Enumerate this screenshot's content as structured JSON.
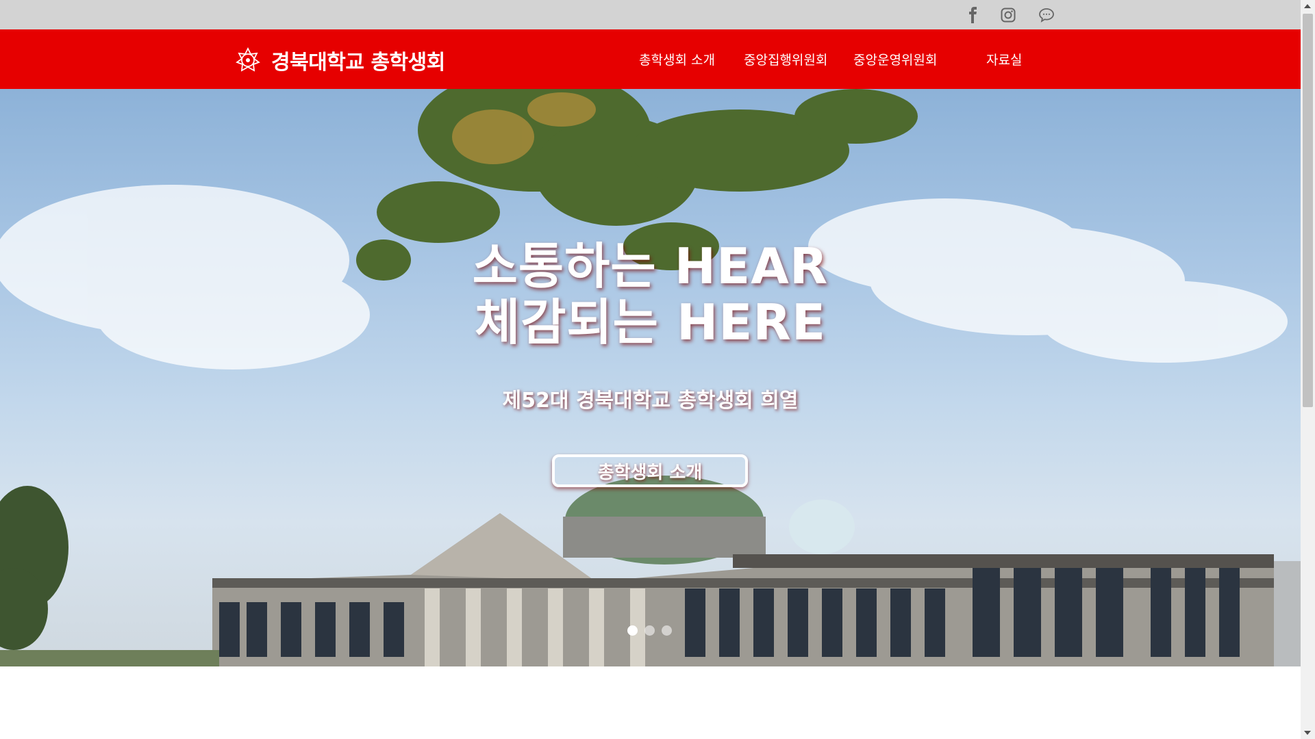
{
  "social": {
    "facebook_icon": "facebook-icon",
    "instagram_icon": "instagram-icon",
    "kakao_icon": "chat-bubble-icon"
  },
  "header": {
    "logo_text": "경북대학교 총학생회",
    "brand_color": "#e60000",
    "nav": [
      {
        "label": "총학생회 소개"
      },
      {
        "label": "중앙집행위원회"
      },
      {
        "label": "중앙운영위원회"
      },
      {
        "label": "자료실"
      }
    ]
  },
  "hero": {
    "headline_line1": "소통하는 HEAR",
    "headline_line2": "체감되는 HERE",
    "subtitle": "제52대 경북대학교 총학생회 희열",
    "button_label": "총학생회 소개",
    "slides_total": 3,
    "active_slide": 1
  }
}
